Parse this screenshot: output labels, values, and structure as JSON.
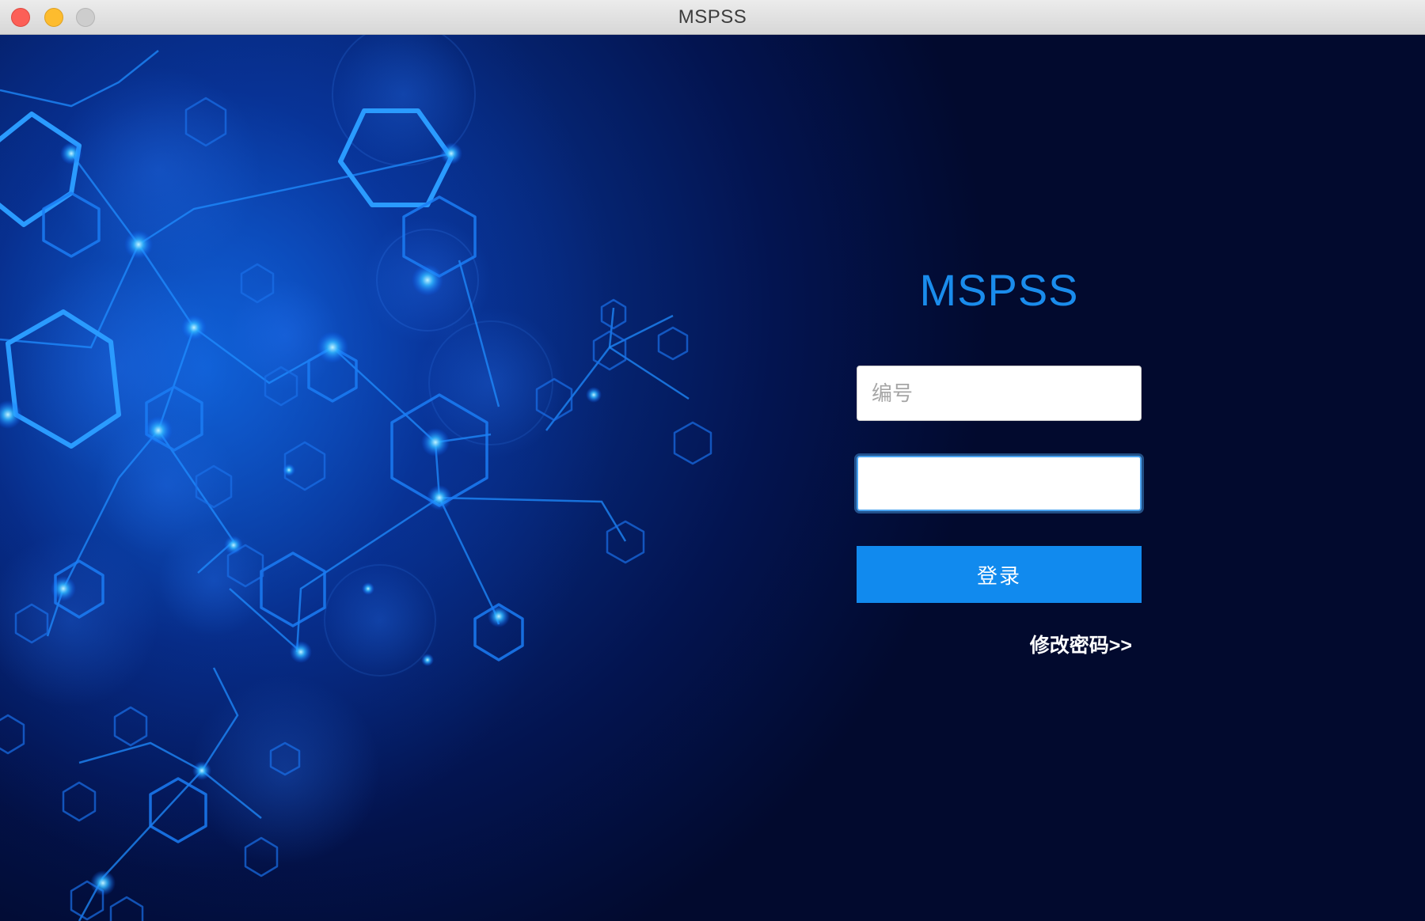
{
  "window": {
    "title": "MSPSS"
  },
  "login": {
    "app_title": "MSPSS",
    "id_placeholder": "编号",
    "password_value": "",
    "login_button": "登录",
    "change_password_link": "修改密码>>"
  },
  "colors": {
    "accent": "#118aee",
    "title_blue": "#1a8cec",
    "background_dark": "#020a2e",
    "background_blue": "#0a3fa8"
  },
  "icons": {
    "close": "close-icon",
    "minimize": "minimize-icon",
    "zoom": "zoom-icon"
  }
}
